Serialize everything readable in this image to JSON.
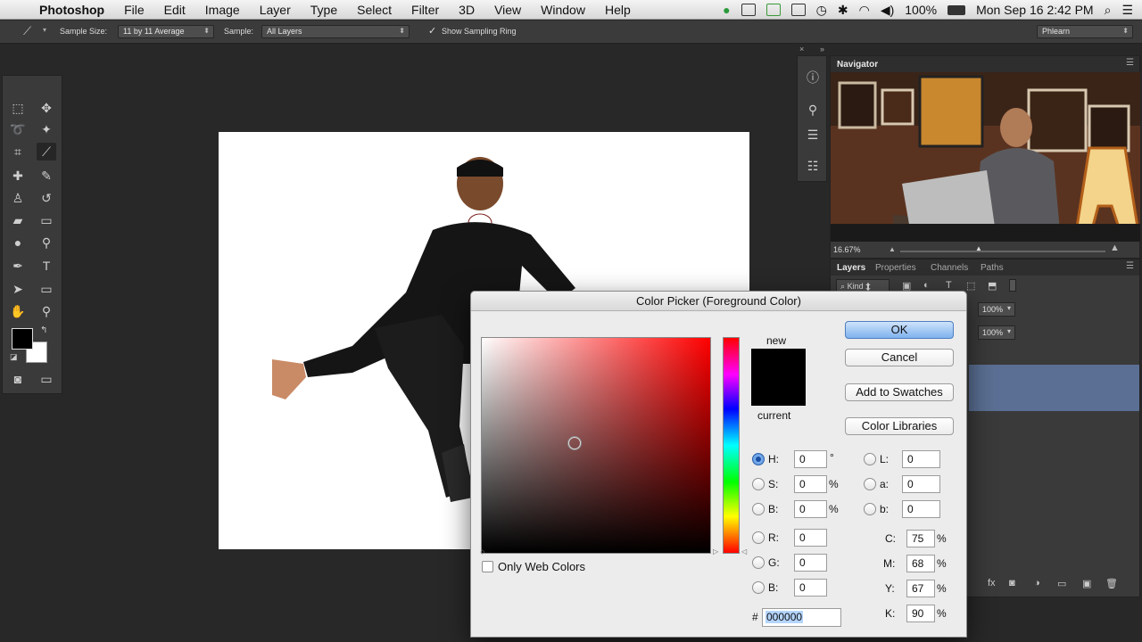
{
  "menubar": {
    "app": "Photoshop",
    "items": [
      "File",
      "Edit",
      "Image",
      "Layer",
      "Type",
      "Select",
      "Filter",
      "3D",
      "View",
      "Window",
      "Help"
    ],
    "battery": "100%",
    "clock": "Mon Sep 16  2:42 PM"
  },
  "optionsbar": {
    "sample_size_label": "Sample Size:",
    "sample_size_value": "11 by 11 Average",
    "sample_label": "Sample:",
    "sample_value": "All Layers",
    "sampling_ring_label": "Show Sampling Ring",
    "sampling_ring_checked": true,
    "workspace": "Phlearn"
  },
  "navigator": {
    "tab": "Navigator",
    "zoom": "16.67%"
  },
  "layers": {
    "tabs": [
      "Layers",
      "Properties",
      "Channels",
      "Paths"
    ],
    "filter": "Kind",
    "opacity": "100%",
    "fill": "100%"
  },
  "dialog": {
    "title": "Color Picker (Foreground Color)",
    "new_label": "new",
    "current_label": "current",
    "new_color": "#000000",
    "current_color": "#000000",
    "buttons": {
      "ok": "OK",
      "cancel": "Cancel",
      "add_swatches": "Add to Swatches",
      "color_libraries": "Color Libraries"
    },
    "only_web_colors": "Only Web Colors",
    "hsb": {
      "h_label": "H:",
      "h": "0",
      "h_unit": "°",
      "s_label": "S:",
      "s": "0",
      "s_unit": "%",
      "b_label": "B:",
      "b": "0",
      "b_unit": "%"
    },
    "rgb": {
      "r_label": "R:",
      "r": "0",
      "g_label": "G:",
      "g": "0",
      "b_label": "B:",
      "b": "0"
    },
    "lab": {
      "l_label": "L:",
      "l": "0",
      "a_label": "a:",
      "a": "0",
      "b_label": "b:",
      "b": "0"
    },
    "cmyk": {
      "c_label": "C:",
      "c": "75",
      "m_label": "M:",
      "m": "68",
      "y_label": "Y:",
      "y": "67",
      "k_label": "K:",
      "k": "90",
      "unit": "%"
    },
    "hex_prefix": "#",
    "hex": "000000"
  }
}
